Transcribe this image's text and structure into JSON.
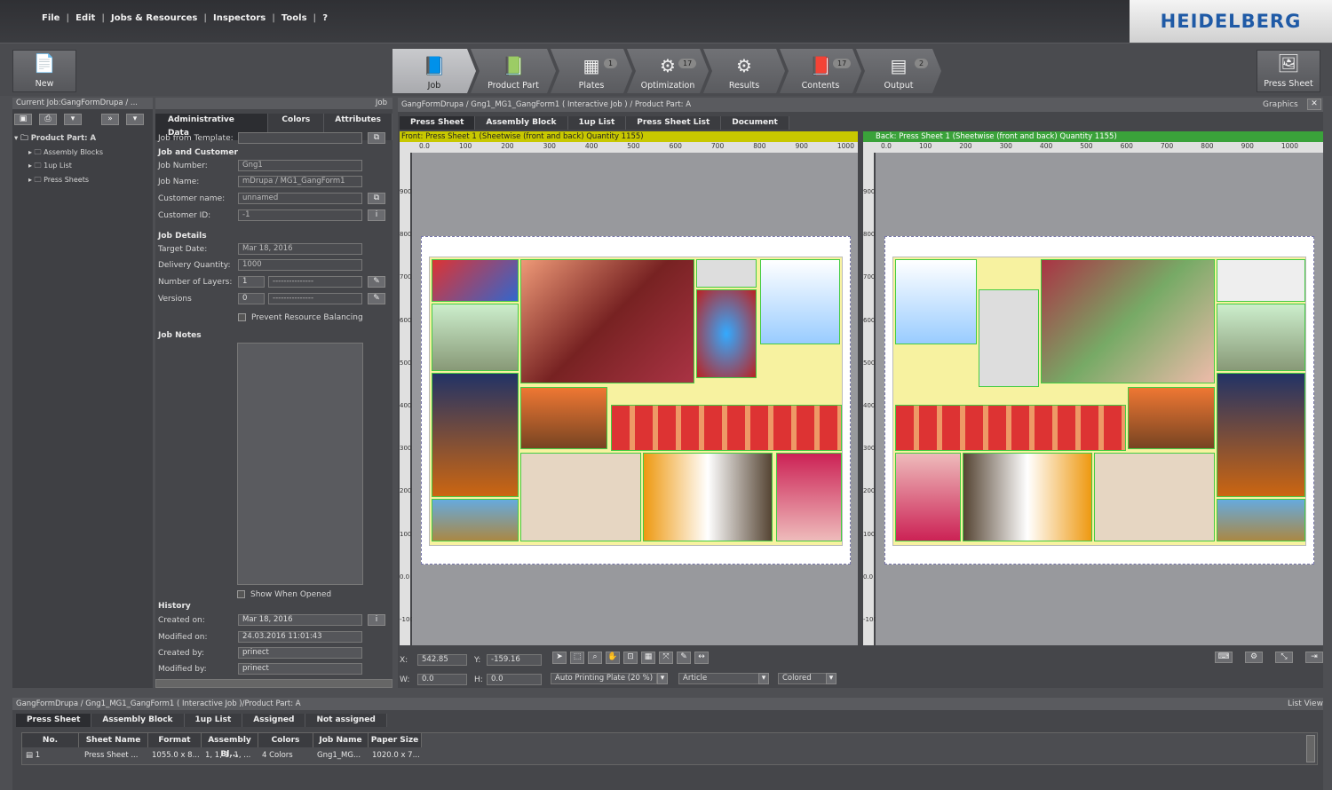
{
  "menu": [
    "File",
    "Edit",
    "Jobs & Resources",
    "Inspectors",
    "Tools",
    "?"
  ],
  "brand": "HEIDELBERG",
  "toolbar": {
    "new_label": "New",
    "press_sheet_label": "Press Sheet"
  },
  "workflow": [
    {
      "label": "Job",
      "badge": ""
    },
    {
      "label": "Product Part",
      "badge": ""
    },
    {
      "label": "Plates",
      "badge": "1"
    },
    {
      "label": "Optimization",
      "badge": "17"
    },
    {
      "label": "Results",
      "badge": ""
    },
    {
      "label": "Contents",
      "badge": "17"
    },
    {
      "label": "Output",
      "badge": "2"
    }
  ],
  "left_panel": {
    "title": "Current Job:GangFormDrupa / ...",
    "tree_root": "Product Part: A",
    "tree_items": [
      "Assembly Blocks",
      "1up List",
      "Press Sheets"
    ]
  },
  "job_panel": {
    "title": "Job",
    "tabs": [
      "Administrative Data",
      "Colors",
      "Attributes"
    ],
    "job_from_template_label": "Job from Template:",
    "section_job_customer": "Job and Customer",
    "job_number_label": "Job Number:",
    "job_number": "Gng1",
    "job_name_label": "Job Name:",
    "job_name": "mDrupa / MG1_GangForm1",
    "customer_name_label": "Customer name:",
    "customer_name": "unnamed",
    "customer_id_label": "Customer ID:",
    "customer_id": "-1",
    "section_job_details": "Job Details",
    "target_date_label": "Target Date:",
    "target_date": "Mar 18, 2016",
    "delivery_qty_label": "Delivery Quantity:",
    "delivery_qty": "1000",
    "layers_label": "Number of Layers:",
    "layers": "1",
    "layers_combo": "---------------",
    "versions_label": "Versions",
    "versions": "0",
    "versions_combo": "---------------",
    "prevent_label": "Prevent Resource Balancing",
    "section_notes": "Job Notes",
    "show_when_opened": "Show When Opened",
    "section_history": "History",
    "created_on_label": "Created on:",
    "created_on": "Mar 18, 2016",
    "modified_on_label": "Modified on:",
    "modified_on": "24.03.2016  11:01:43",
    "created_by_label": "Created by:",
    "created_by": "prinect",
    "modified_by_label": "Modified by:",
    "modified_by": "prinect"
  },
  "graphics": {
    "path": "GangFormDrupa / Gng1_MG1_GangForm1  ( Interactive Job )  / Product Part: A",
    "title": "Graphics",
    "tabs": [
      "Press Sheet",
      "Assembly Block",
      "1up List",
      "Press Sheet List",
      "Document"
    ],
    "front_label": "Front:  Press Sheet 1 (Sheetwise (front and back) Quantity 1155)",
    "back_label": "Back:  Press Sheet 1 (Sheetwise (front and back) Quantity 1155)",
    "ruler_h": [
      "0.0",
      "100",
      "200",
      "300",
      "400",
      "500",
      "600",
      "700",
      "800",
      "900",
      "1000"
    ],
    "ruler_v": [
      "900",
      "800",
      "700",
      "600",
      "500",
      "400",
      "300",
      "200",
      "100",
      "0.0",
      "-100"
    ],
    "x_label": "X:",
    "x_value": "542.85",
    "y_label": "Y:",
    "y_value": "-159.16",
    "w_label": "W:",
    "w_value": "0.0",
    "h_label": "H:",
    "h_value": "0.0",
    "plate_combo": "Auto Printing Plate (20 %)",
    "article_combo": "Article",
    "colored_combo": "Colored"
  },
  "list_view": {
    "path": "GangFormDrupa / Gng1_MG1_GangForm1  ( Interactive Job )/Product Part: A",
    "title": "List View",
    "tabs": [
      "Press Sheet",
      "Assembly Block",
      "1up List",
      "Assigned",
      "Not assigned"
    ],
    "columns": [
      "No.",
      "Sheet Name",
      "Format",
      "Assembly Bl...",
      "Colors",
      "Job Name",
      "Paper Size"
    ],
    "rows": [
      [
        "1",
        "Press Sheet ...",
        "1055.0 x 8...",
        "1, 1, 1, 1, ...",
        "4 Colors",
        "Gng1_MG...",
        "1020.0 x 7..."
      ]
    ]
  },
  "colors": {
    "accent_front": "#c8c800",
    "accent_back": "#3aa23a",
    "brand": "#1f5aa6"
  }
}
